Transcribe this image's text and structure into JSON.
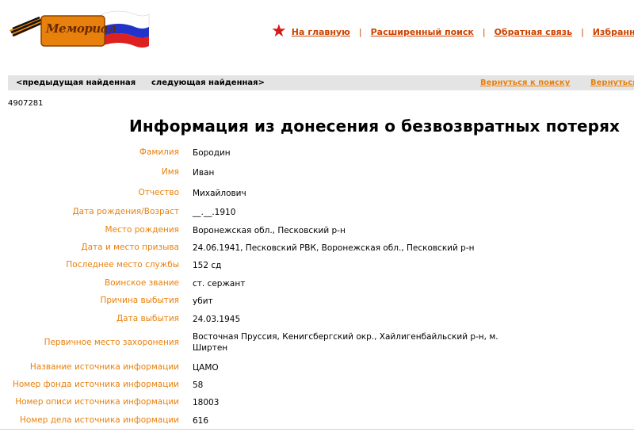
{
  "header": {
    "logo_text": "Мемориал",
    "nav": [
      {
        "label": "На главную"
      },
      {
        "label": "Расширенный поиск"
      },
      {
        "label": "Обратная связь"
      },
      {
        "label": "Избранное"
      }
    ]
  },
  "navbar": {
    "prev_label": "<предыдущая найденная",
    "next_label": "следующая найденная>",
    "back_label": "Вернуться к поиску",
    "back2_label": "Вернуться"
  },
  "record_id": "4907281",
  "title": "Информация из донесения о безвозвратных потерях",
  "fields": [
    {
      "label": "Фамилия",
      "value": "Бородин"
    },
    {
      "label": "Имя",
      "value": "Иван"
    },
    {
      "label": "Отчество",
      "value": "Михайлович"
    },
    {
      "label": "Дата рождения/Возраст",
      "value": "__.__.1910"
    },
    {
      "label": "Место рождения",
      "value": "Воронежская обл., Песковский р-н"
    },
    {
      "label": "Дата и место призыва",
      "value": "24.06.1941, Песковский РВК, Воронежская обл., Песковский р-н"
    },
    {
      "label": "Последнее место службы",
      "value": "152 сд"
    },
    {
      "label": "Воинское звание",
      "value": "ст. сержант"
    },
    {
      "label": "Причина выбытия",
      "value": "убит"
    },
    {
      "label": "Дата выбытия",
      "value": "24.03.1945"
    },
    {
      "label": "Первичное место захоронения",
      "value": "Восточная Пруссия, Кенигсбергский окр., Хайлигенбайльский р-н, м. Ширтен"
    },
    {
      "label": "Название источника информации",
      "value": "ЦАМО"
    },
    {
      "label": "Номер фонда источника информации",
      "value": "58"
    },
    {
      "label": "Номер описи источника информации",
      "value": "18003"
    },
    {
      "label": "Номер дела источника информации",
      "value": "616"
    }
  ],
  "colors": {
    "accent": "#e8800c",
    "link": "#cc4400",
    "star": "#d81818",
    "navbar_bg": "#e4e4e4"
  }
}
